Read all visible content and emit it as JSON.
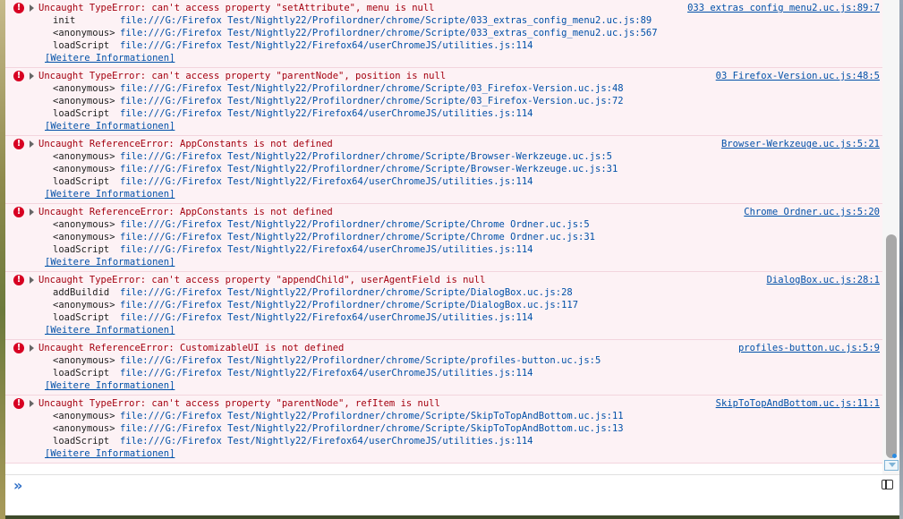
{
  "console": {
    "more_info_label": "[Weitere Informationen]",
    "messages": [
      {
        "text": "Uncaught TypeError: can't access property \"setAttribute\", menu is null",
        "source": "033 extras config menu2.uc.js:89:7",
        "frames": [
          {
            "fn": "init",
            "loc": "file:///G:/Firefox Test/Nightly22/Profilordner/chrome/Scripte/033_extras_config_menu2.uc.js:89"
          },
          {
            "fn": "<anonymous>",
            "loc": "file:///G:/Firefox Test/Nightly22/Profilordner/chrome/Scripte/033_extras_config_menu2.uc.js:567"
          },
          {
            "fn": "loadScript",
            "loc": "file:///G:/Firefox Test/Nightly22/Firefox64/userChromeJS/utilities.js:114"
          }
        ]
      },
      {
        "text": "Uncaught TypeError: can't access property \"parentNode\", position is null",
        "source": "03 Firefox-Version.uc.js:48:5",
        "frames": [
          {
            "fn": "<anonymous>",
            "loc": "file:///G:/Firefox Test/Nightly22/Profilordner/chrome/Scripte/03_Firefox-Version.uc.js:48"
          },
          {
            "fn": "<anonymous>",
            "loc": "file:///G:/Firefox Test/Nightly22/Profilordner/chrome/Scripte/03_Firefox-Version.uc.js:72"
          },
          {
            "fn": "loadScript",
            "loc": "file:///G:/Firefox Test/Nightly22/Firefox64/userChromeJS/utilities.js:114"
          }
        ]
      },
      {
        "text": "Uncaught ReferenceError: AppConstants is not defined",
        "source": "Browser-Werkzeuge.uc.js:5:21",
        "frames": [
          {
            "fn": "<anonymous>",
            "loc": "file:///G:/Firefox Test/Nightly22/Profilordner/chrome/Scripte/Browser-Werkzeuge.uc.js:5"
          },
          {
            "fn": "<anonymous>",
            "loc": "file:///G:/Firefox Test/Nightly22/Profilordner/chrome/Scripte/Browser-Werkzeuge.uc.js:31"
          },
          {
            "fn": "loadScript",
            "loc": "file:///G:/Firefox Test/Nightly22/Firefox64/userChromeJS/utilities.js:114"
          }
        ]
      },
      {
        "text": "Uncaught ReferenceError: AppConstants is not defined",
        "source": "Chrome Ordner.uc.js:5:20",
        "frames": [
          {
            "fn": "<anonymous>",
            "loc": "file:///G:/Firefox Test/Nightly22/Profilordner/chrome/Scripte/Chrome Ordner.uc.js:5"
          },
          {
            "fn": "<anonymous>",
            "loc": "file:///G:/Firefox Test/Nightly22/Profilordner/chrome/Scripte/Chrome Ordner.uc.js:31"
          },
          {
            "fn": "loadScript",
            "loc": "file:///G:/Firefox Test/Nightly22/Firefox64/userChromeJS/utilities.js:114"
          }
        ]
      },
      {
        "text": "Uncaught TypeError: can't access property \"appendChild\", userAgentField is null",
        "source": "DialogBox.uc.js:28:1",
        "frames": [
          {
            "fn": "addBuildid",
            "loc": "file:///G:/Firefox Test/Nightly22/Profilordner/chrome/Scripte/DialogBox.uc.js:28"
          },
          {
            "fn": "<anonymous>",
            "loc": "file:///G:/Firefox Test/Nightly22/Profilordner/chrome/Scripte/DialogBox.uc.js:117"
          },
          {
            "fn": "loadScript",
            "loc": "file:///G:/Firefox Test/Nightly22/Firefox64/userChromeJS/utilities.js:114"
          }
        ]
      },
      {
        "text": "Uncaught ReferenceError: CustomizableUI is not defined",
        "source": "profiles-button.uc.js:5:9",
        "frames": [
          {
            "fn": "<anonymous>",
            "loc": "file:///G:/Firefox Test/Nightly22/Profilordner/chrome/Scripte/profiles-button.uc.js:5"
          },
          {
            "fn": "loadScript",
            "loc": "file:///G:/Firefox Test/Nightly22/Firefox64/userChromeJS/utilities.js:114"
          }
        ]
      },
      {
        "text": "Uncaught TypeError: can't access property \"parentNode\", refItem is null",
        "source": "SkipToTopAndBottom.uc.js:11:1",
        "frames": [
          {
            "fn": "<anonymous>",
            "loc": "file:///G:/Firefox Test/Nightly22/Profilordner/chrome/Scripte/SkipToTopAndBottom.uc.js:11"
          },
          {
            "fn": "<anonymous>",
            "loc": "file:///G:/Firefox Test/Nightly22/Profilordner/chrome/Scripte/SkipToTopAndBottom.uc.js:13"
          },
          {
            "fn": "loadScript",
            "loc": "file:///G:/Firefox Test/Nightly22/Firefox64/userChromeJS/utilities.js:114"
          }
        ]
      }
    ]
  },
  "input": {
    "prompt_glyph": "»",
    "placeholder": ""
  },
  "colors": {
    "error_text": "#a4000f",
    "link": "#0050a8",
    "row_bg": "#fdf2f5"
  },
  "icons": {
    "error": "error-icon",
    "twisty": "expand-triangle-icon",
    "sidebar": "sidebar-toggle-icon"
  }
}
